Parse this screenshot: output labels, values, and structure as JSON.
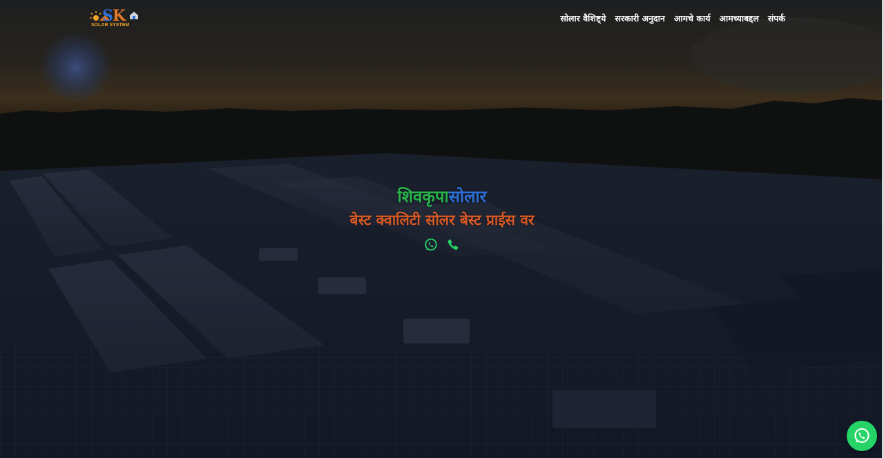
{
  "logo": {
    "initials_s": "S",
    "initials_k": "K",
    "subtitle": "SOLAR SYSTEM"
  },
  "nav": {
    "items": [
      {
        "label": "सोलार वैशिष्ट्ये"
      },
      {
        "label": "सरकारी अनुदान"
      },
      {
        "label": "आमचे कार्य"
      },
      {
        "label": "आमच्याबद्दल"
      },
      {
        "label": "संपर्क"
      }
    ]
  },
  "hero": {
    "title_part1": "शिवकृपा",
    "title_part2": "सोलार",
    "tagline": "बेस्ट क्वालिटी सोलर बेस्ट प्राईस वर",
    "icons": [
      "whatsapp-icon",
      "phone-icon"
    ]
  },
  "colors": {
    "title_green": "#27b34a",
    "title_blue": "#2d6fd6",
    "tagline_orange": "#d85a26",
    "icon_green": "#25d366",
    "nav_text": "#ffffff"
  },
  "floating_button": {
    "icon": "whatsapp-icon"
  }
}
